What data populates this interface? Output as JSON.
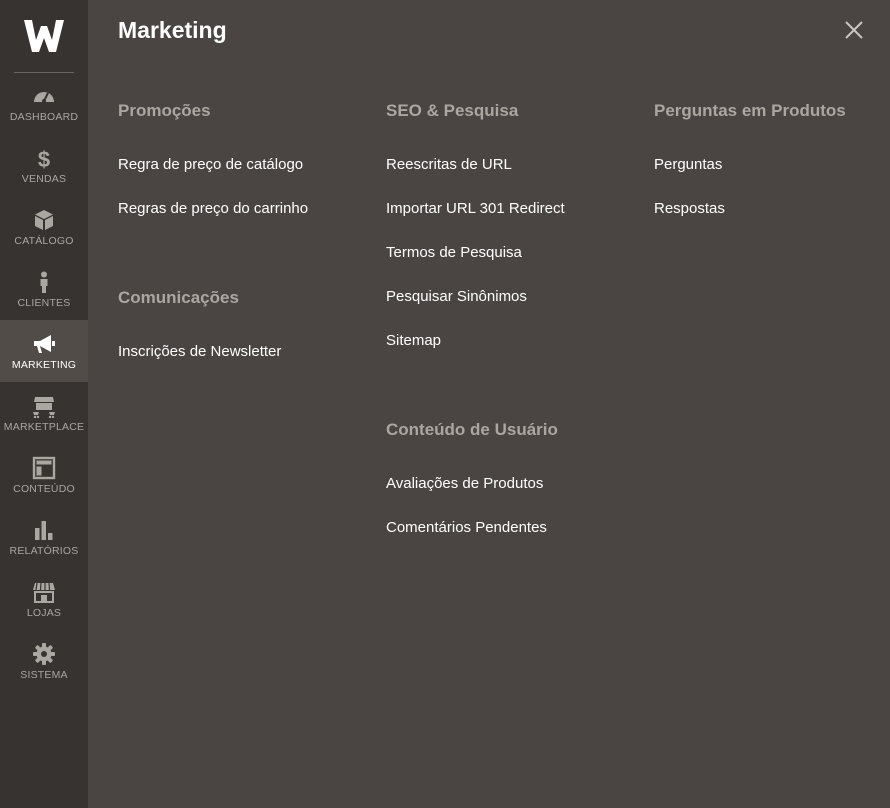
{
  "sidebar": {
    "logo": "W",
    "items": [
      {
        "label": "Dashboard",
        "icon": "dashboard-icon"
      },
      {
        "label": "Vendas",
        "icon": "dollar-icon"
      },
      {
        "label": "Catálogo",
        "icon": "box-icon"
      },
      {
        "label": "Clientes",
        "icon": "person-icon"
      },
      {
        "label": "Marketing",
        "icon": "megaphone-icon",
        "active": true
      },
      {
        "label": "Marketplace",
        "icon": "marketplace-icon"
      },
      {
        "label": "Conteúdo",
        "icon": "layout-icon"
      },
      {
        "label": "Relatórios",
        "icon": "bar-chart-icon"
      },
      {
        "label": "Lojas",
        "icon": "store-icon"
      },
      {
        "label": "Sistema",
        "icon": "gear-icon"
      }
    ]
  },
  "panel": {
    "title": "Marketing",
    "close_icon": "close-icon",
    "groups": {
      "promocoes": {
        "title": "Promoções",
        "links": [
          "Regra de preço de catálogo",
          "Regras de preço do carrinho"
        ]
      },
      "comunicacoes": {
        "title": "Comunicações",
        "links": [
          "Inscrições de Newsletter"
        ]
      },
      "seo": {
        "title": "SEO & Pesquisa",
        "links": [
          "Reescritas de URL",
          "Importar URL 301 Redirect",
          "Termos de Pesquisa",
          "Pesquisar Sinônimos",
          "Sitemap"
        ]
      },
      "conteudo_usuario": {
        "title": "Conteúdo de Usuário",
        "links": [
          "Avaliações de Produtos",
          "Comentários Pendentes"
        ]
      },
      "perguntas": {
        "title": "Perguntas em Produtos",
        "links": [
          "Perguntas",
          "Respostas"
        ]
      }
    }
  },
  "colors": {
    "sidebar_bg": "#373330",
    "sidebar_active_bg": "#514c48",
    "panel_bg": "#4a4542",
    "group_title": "#aaa6a0",
    "link": "#ffffff"
  }
}
